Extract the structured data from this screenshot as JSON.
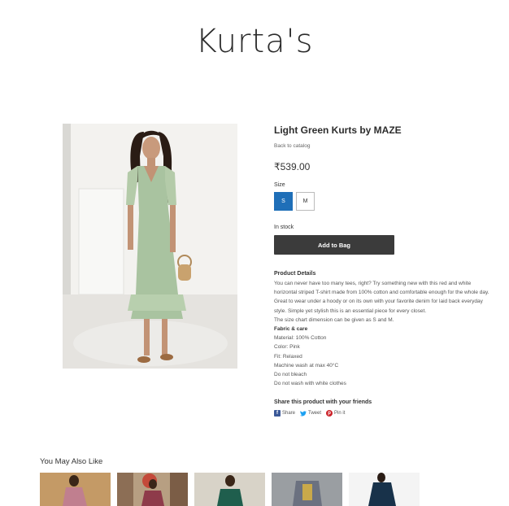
{
  "header": {
    "title": "Kurta's"
  },
  "product": {
    "title": "Light Green Kurts by MAZE",
    "back_link": "Back to catalog",
    "price": "₹539.00",
    "size_label": "Size",
    "sizes": [
      "S",
      "M"
    ],
    "selected_size": "S",
    "stock": "In stock",
    "add_to_bag": "Add to Bag",
    "details_heading": "Product Details",
    "description_1": "You can never have too many tees, right? Try something new with this red and white horizontal striped T-shirt made from 100% cotton and comfortable enough for the whole day. Great to wear under a hoody or on its own with your favorite denim for laid back everyday style. Simple yet stylish this is an essential piece for every closet.",
    "description_2": "The size chart dimension can be given as S and M.",
    "fabric_heading": "Fabric & care",
    "material": "Material: 100% Cotton",
    "color": "Color: Pink",
    "fit": "Fit: Relaxed",
    "care_1": "Machine wash at max 40°C",
    "care_2": "Do not bleach",
    "care_3": "Do not wash with white clothes"
  },
  "share": {
    "heading": "Share this product with your friends",
    "facebook": "Share",
    "twitter": "Tweet",
    "pinterest": "Pin it"
  },
  "related": {
    "heading": "You May Also Like"
  },
  "colors": {
    "accent": "#1f6fb8",
    "button_dark": "#3b3b3b"
  }
}
